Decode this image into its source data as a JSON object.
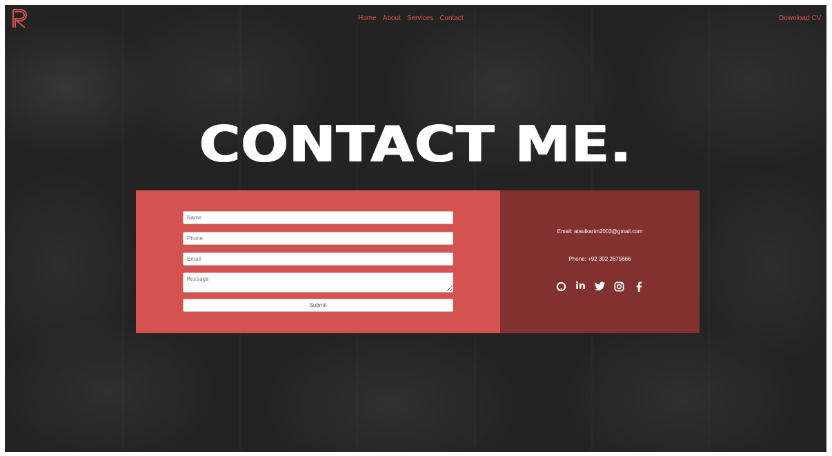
{
  "header": {
    "nav": [
      "Home",
      "About",
      "Services",
      "Contact"
    ],
    "download_label": "Download CV",
    "accent_color": "#d4524f"
  },
  "hero": {
    "title": "CONTACT ME."
  },
  "form": {
    "name_placeholder": "Name",
    "phone_placeholder": "Phone",
    "email_placeholder": "Email",
    "message_placeholder": "Message",
    "submit_label": "Submit",
    "panel_color": "#d4524f"
  },
  "info": {
    "email": "Email: ataulkarim2003@gmail.com",
    "phone": "Phone: +92 302 2675666",
    "panel_color": "#823131",
    "socials": [
      "github-icon",
      "linkedin-icon",
      "twitter-icon",
      "instagram-icon",
      "facebook-icon"
    ]
  }
}
